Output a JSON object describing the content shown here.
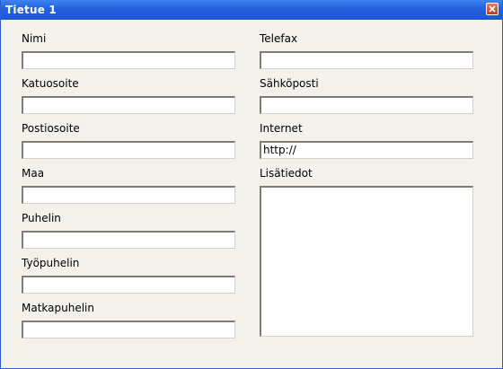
{
  "window": {
    "title": "Tietue 1"
  },
  "fields_left": [
    {
      "label": "Nimi",
      "value": ""
    },
    {
      "label": "Katuosoite",
      "value": ""
    },
    {
      "label": "Postiosoite",
      "value": ""
    },
    {
      "label": "Maa",
      "value": ""
    },
    {
      "label": "Puhelin",
      "value": ""
    },
    {
      "label": "Työpuhelin",
      "value": ""
    },
    {
      "label": "Matkapuhelin",
      "value": ""
    }
  ],
  "fields_right": [
    {
      "label": "Telefax",
      "value": ""
    },
    {
      "label": "Sähköposti",
      "value": ""
    },
    {
      "label": "Internet",
      "value": "http://"
    },
    {
      "label": "Lisätiedot",
      "value": ""
    }
  ],
  "icons": {
    "close": "close-icon"
  },
  "colors": {
    "titlebar": "#2563e0",
    "background": "#f3f1ec",
    "close_button": "#c4371e"
  }
}
